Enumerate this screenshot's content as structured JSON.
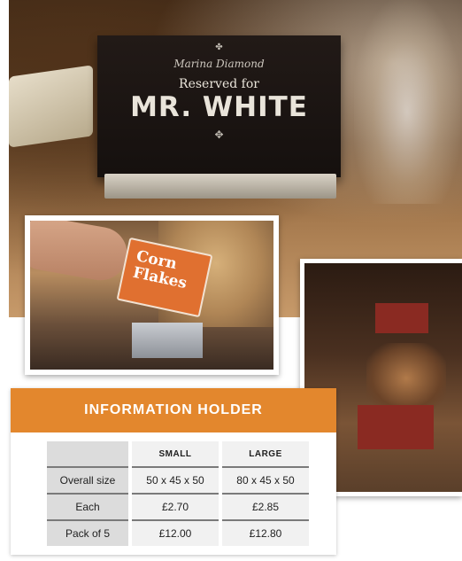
{
  "hero": {
    "sign": {
      "restaurant_name": "Marina Diamond",
      "reserved_text": "Reserved for",
      "guest_name": "MR. WHITE"
    }
  },
  "inset_corn_flakes": {
    "card_text_line1": "Corn",
    "card_text_line2": "Flakes"
  },
  "info_panel": {
    "title": "INFORMATION HOLDER",
    "columns": [
      "",
      "SMALL",
      "LARGE"
    ],
    "rows": [
      {
        "label": "Overall size",
        "small": "50 x 45 x 50",
        "large": "80 x 45 x 50"
      },
      {
        "label": "Each",
        "small": "£2.70",
        "large": "£2.85"
      },
      {
        "label": "Pack of 5",
        "small": "£12.00",
        "large": "£12.80"
      }
    ],
    "header_color": "#e3872d"
  }
}
